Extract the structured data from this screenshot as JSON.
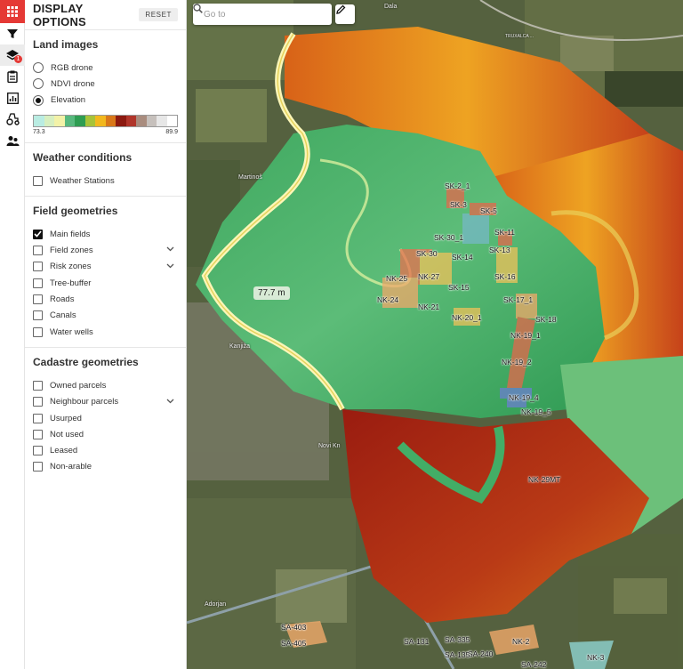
{
  "rail": {
    "layers_badge": "1",
    "icons": [
      "filter-icon",
      "layers-icon",
      "clipboard-icon",
      "chart-icon",
      "tractor-icon",
      "people-icon"
    ]
  },
  "panel": {
    "title": "DISPLAY OPTIONS",
    "reset_label": "RESET",
    "land_images": {
      "title": "Land images",
      "options": [
        {
          "label": "RGB drone",
          "selected": false
        },
        {
          "label": "NDVI drone",
          "selected": false
        },
        {
          "label": "Elevation",
          "selected": true
        }
      ],
      "legend_colors": [
        "#b9ece2",
        "#d7efc0",
        "#f3f2a8",
        "#58b97e",
        "#2e9d52",
        "#a7c339",
        "#f2b81e",
        "#d9781a",
        "#8c1a10",
        "#b0352a",
        "#a98c7e",
        "#c6c0bc",
        "#e7e7e7",
        "#ffffff"
      ],
      "legend_min": "73.3",
      "legend_max": "89.9"
    },
    "weather": {
      "title": "Weather conditions",
      "options": [
        {
          "label": "Weather Stations",
          "checked": false
        }
      ]
    },
    "field_geometries": {
      "title": "Field geometries",
      "options": [
        {
          "label": "Main fields",
          "checked": true,
          "expandable": false
        },
        {
          "label": "Field zones",
          "checked": false,
          "expandable": true
        },
        {
          "label": "Risk zones",
          "checked": false,
          "expandable": true
        },
        {
          "label": "Tree-buffer",
          "checked": false,
          "expandable": false
        },
        {
          "label": "Roads",
          "checked": false,
          "expandable": false
        },
        {
          "label": "Canals",
          "checked": false,
          "expandable": false
        },
        {
          "label": "Water wells",
          "checked": false,
          "expandable": false
        }
      ]
    },
    "cadastre_geometries": {
      "title": "Cadastre geometries",
      "options": [
        {
          "label": "Owned parcels",
          "checked": false,
          "expandable": false
        },
        {
          "label": "Neighbour parcels",
          "checked": false,
          "expandable": true
        },
        {
          "label": "Usurped",
          "checked": false,
          "expandable": false
        },
        {
          "label": "Not used",
          "checked": false,
          "expandable": false
        },
        {
          "label": "Leased",
          "checked": false,
          "expandable": false
        },
        {
          "label": "Non-arable",
          "checked": false,
          "expandable": false
        }
      ]
    }
  },
  "map": {
    "search_placeholder": "Go to",
    "measurement": "77.7 m",
    "places": [
      "Dala",
      "Martinoš",
      "Kanjiža",
      "Novi Kn",
      "Adorjan",
      "TRUXALCA ..."
    ],
    "field_labels": [
      "SK-2_1",
      "SK-3",
      "SK-5",
      "SK-11",
      "SK-30_1",
      "SK-13",
      "SK-30",
      "SK-14",
      "NK-25",
      "NK-27",
      "SK-15",
      "SK-16",
      "NK-24",
      "SK-17_1",
      "NK-21",
      "NK-20_1",
      "SK-18",
      "NK-19_1",
      "NK-19_2",
      "NK-19_4",
      "NK-19_5",
      "NK-29MT",
      "SA-403",
      "SA-405",
      "SA-131",
      "SA-335",
      "NK-2",
      "SA-240",
      "SA-135",
      "SA-242",
      "NK-3"
    ]
  }
}
